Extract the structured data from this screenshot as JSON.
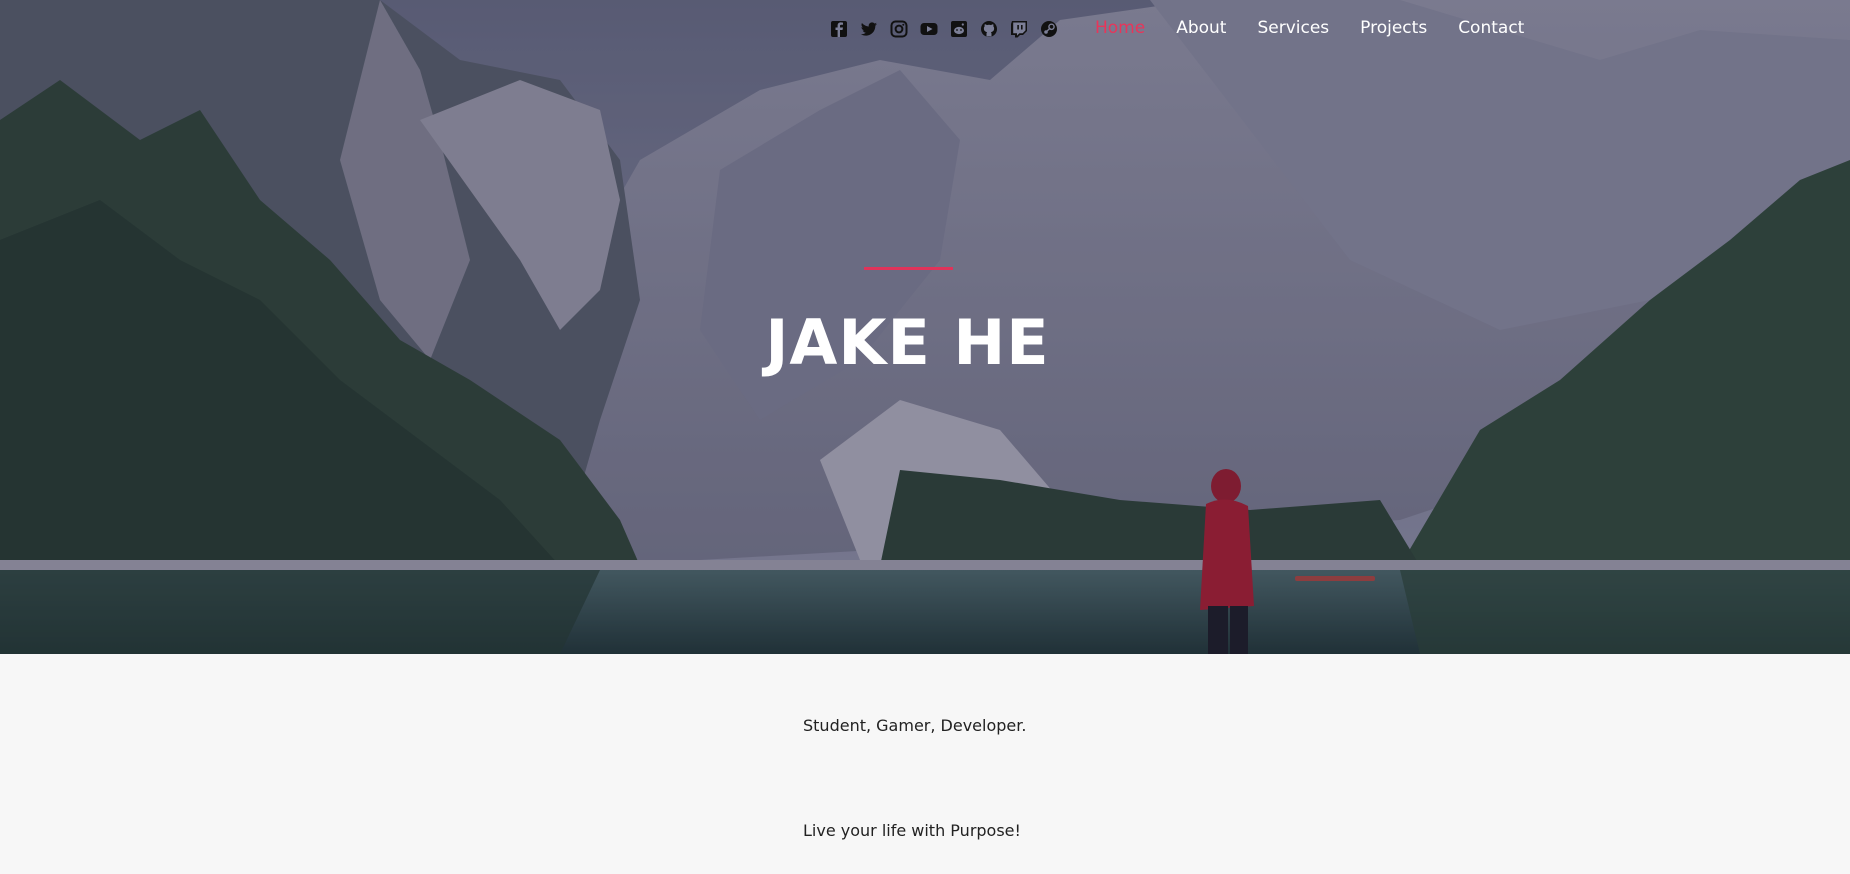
{
  "nav": {
    "social_icons": [
      "facebook-icon",
      "twitter-icon",
      "instagram-icon",
      "youtube-icon",
      "reddit-icon",
      "github-icon",
      "twitch-icon",
      "steam-icon"
    ],
    "items": [
      {
        "label": "Home",
        "active": true
      },
      {
        "label": "About",
        "active": false
      },
      {
        "label": "Services",
        "active": false
      },
      {
        "label": "Projects",
        "active": false
      },
      {
        "label": "Contact",
        "active": false
      }
    ]
  },
  "hero": {
    "title": "JAKE HE"
  },
  "content": {
    "tagline": "Student, Gamer, Developer.",
    "motto": "Live your life with Purpose!"
  },
  "colors": {
    "accent": "#e8355a",
    "background": "#f7f7f7",
    "text": "#222222"
  }
}
